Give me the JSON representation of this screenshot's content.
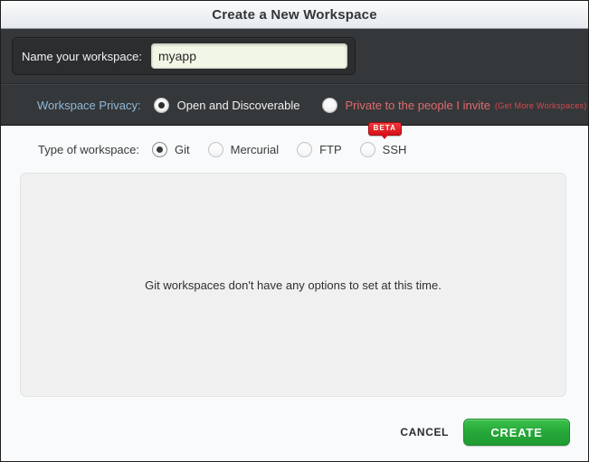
{
  "dialog": {
    "title": "Create a New Workspace"
  },
  "name_section": {
    "label": "Name your workspace:",
    "value": "myapp",
    "placeholder": ""
  },
  "privacy_section": {
    "label": "Workspace Privacy:",
    "options": [
      {
        "label": "Open and Discoverable",
        "selected": true
      },
      {
        "label": "Private to the people I invite",
        "selected": false,
        "note": "(Get More Workspaces)"
      }
    ]
  },
  "type_section": {
    "label": "Type of workspace:",
    "options": [
      {
        "label": "Git",
        "selected": true
      },
      {
        "label": "Mercurial",
        "selected": false
      },
      {
        "label": "FTP",
        "selected": false
      },
      {
        "label": "SSH",
        "selected": false,
        "badge": "BETA"
      }
    ]
  },
  "content": {
    "message": "Git workspaces don't have any options to set at this time."
  },
  "footer": {
    "cancel_label": "CANCEL",
    "create_label": "CREATE"
  },
  "colors": {
    "accent_green": "#27a93a",
    "badge_red": "#d90f18",
    "privacy_label_blue": "#8fb8d8",
    "private_text_red": "#e2696d",
    "dark_panel": "#35383a"
  }
}
